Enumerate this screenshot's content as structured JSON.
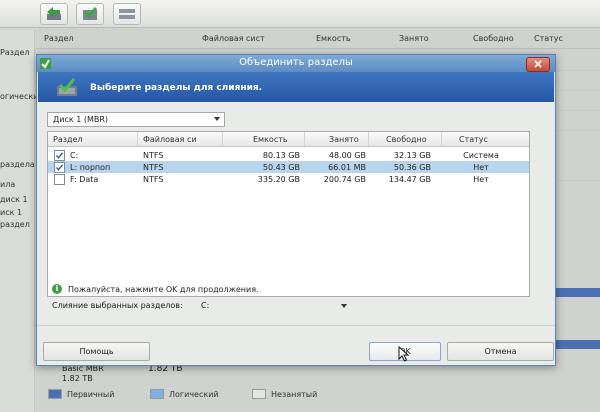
{
  "background": {
    "header_columns": [
      "Раздел",
      "Файловая сист",
      "Емкость",
      "Занято",
      "Свободно",
      "Статус"
    ],
    "left_panel_fragments": [
      "Раздел",
      "огический",
      "раздела",
      "ила",
      "диск 1",
      "раздел",
      "иск 1"
    ],
    "bottom_info": {
      "label": "Basic MBR",
      "size_left": "1.82 TB",
      "size_right": "1.82 TB"
    },
    "legend": [
      "Первичный",
      "Логический",
      "Незанятый"
    ]
  },
  "dialog": {
    "title": "Объединить разделы",
    "banner_text": "Выберите разделы для слияния.",
    "disk_selector": "Диск 1 (MBR)",
    "columns": [
      "Раздел",
      "Файловая си",
      "Емкость",
      "Занято",
      "Свободно",
      "Статус"
    ],
    "rows": [
      {
        "checked": true,
        "partition": "C:",
        "fs": "NTFS",
        "capacity": "80.13 GB",
        "used": "48.00 GB",
        "free": "32.13 GB",
        "status": "Система",
        "selected": false
      },
      {
        "checked": true,
        "partition": "L: порпоп",
        "fs": "NTFS",
        "capacity": "50.43 GB",
        "used": "66.01 MB",
        "free": "50.36 GB",
        "status": "Нет",
        "selected": true
      },
      {
        "checked": false,
        "partition": "F: Data",
        "fs": "NTFS",
        "capacity": "335.20 GB",
        "used": "200.74 GB",
        "free": "134.47 GB",
        "status": "Нет",
        "selected": false
      }
    ],
    "hint": "Пожалуйста, нажмите OK для продолжения.",
    "merge_label": "Слияние выбранных разделов:",
    "merge_target": "C:",
    "buttons": {
      "help": "Помощь",
      "ok": "OK",
      "cancel": "Отмена"
    }
  },
  "colors": {
    "title_bar": "#6a97cc",
    "banner": "#2f63b1",
    "selection": "#b9d4ee",
    "primary": "#4b6fb5"
  }
}
